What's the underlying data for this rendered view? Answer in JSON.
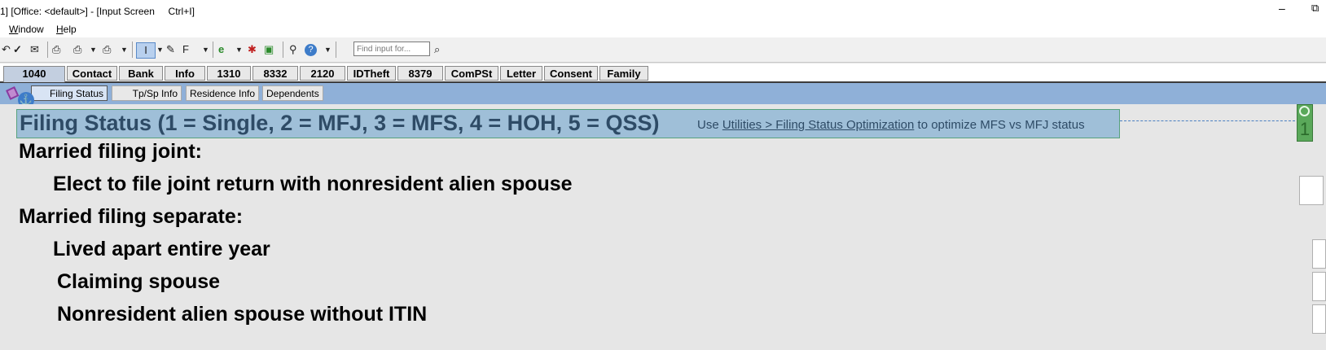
{
  "window": {
    "title": "1] [Office: <default>] - [Input Screen     Ctrl+I]",
    "minimize_glyph": "–",
    "restore_glyph": "⧉"
  },
  "menu": {
    "items": [
      "Window",
      "Help"
    ]
  },
  "toolbar": {
    "find_placeholder": "Find input for...",
    "icons": [
      "undo-icon",
      "check-icon",
      "envelope-icon",
      "print-icon",
      "print-preview-icon",
      "dropdown-icon",
      "print-options-icon",
      "dropdown-icon",
      "input-mode-icon",
      "dropdown-icon",
      "tools-icon",
      "form-select-icon",
      "dropdown-icon",
      "web-icon",
      "dropdown-icon",
      "bug-icon",
      "export-icon",
      "binoculars-icon",
      "help-icon",
      "dropdown-icon",
      "find-icon"
    ]
  },
  "tabs": [
    "1040",
    "Contact",
    "Bank",
    "Info",
    "1310",
    "8332",
    "2120",
    "IDTheft",
    "8379",
    "ComPSt",
    "Letter",
    "Consent",
    "Family"
  ],
  "active_tab": "1040",
  "subtabs": [
    "Filing Status",
    "Tp/Sp  Info",
    "Residence Info",
    "Dependents"
  ],
  "active_subtab": "Filing Status",
  "header": {
    "title": "Filing Status (1 = Single, 2 = MFJ, 3 = MFS, 4 = HOH, 5 = QSS)",
    "note_pre": "Use ",
    "note_link": "Utilities > Filing Status Optimization",
    "note_post": " to optimize MFS vs MFJ status",
    "value": "1"
  },
  "rows": [
    {
      "label": "Married filing joint:"
    },
    {
      "label": "Elect to file joint return with nonresident alien spouse"
    },
    {
      "label": "Married filing separate:"
    },
    {
      "label": "Lived apart entire year"
    },
    {
      "label": "Claiming spouse"
    },
    {
      "label": "Nonresident alien spouse without  ITIN"
    }
  ],
  "colors": {
    "accent": "#8fb0d8",
    "header_band": "#9fbfd8",
    "header_text": "#2e4b66",
    "marker": "#5aa85a"
  }
}
